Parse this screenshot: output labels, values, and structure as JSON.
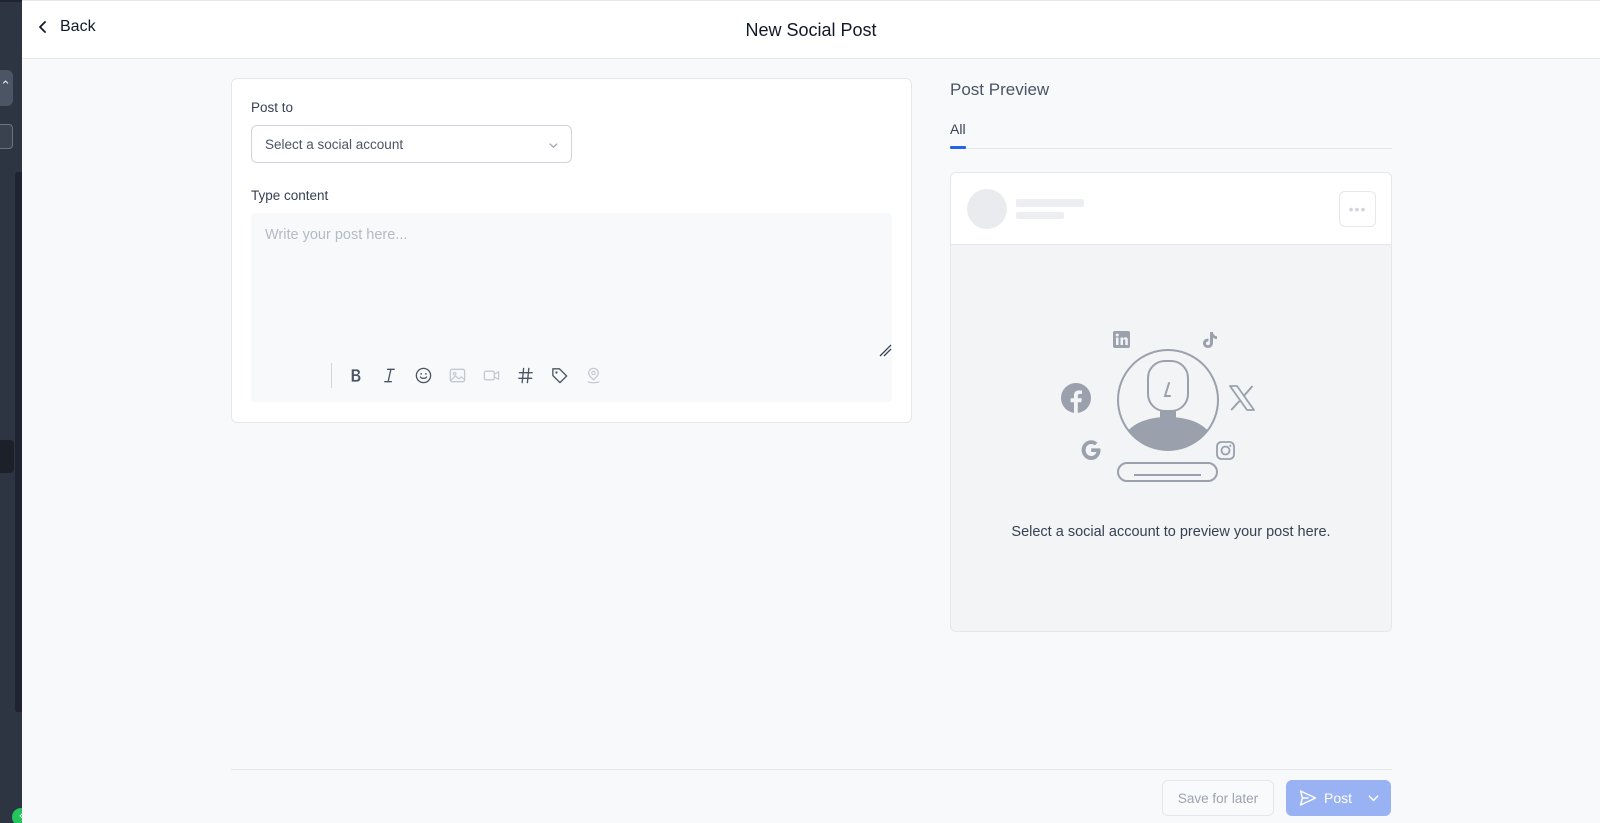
{
  "header": {
    "back_label": "Back",
    "title": "New Social Post"
  },
  "form": {
    "post_to_label": "Post to",
    "account_select_placeholder": "Select a social account",
    "content_label": "Type content",
    "content_placeholder": "Write your post here...",
    "content_value": "",
    "toolbar_icons": [
      "bold-icon",
      "italic-icon",
      "emoji-icon",
      "image-icon",
      "video-icon",
      "hashtag-icon",
      "tag-icon",
      "location-icon"
    ]
  },
  "preview": {
    "title": "Post Preview",
    "tabs": [
      {
        "label": "All",
        "active": true
      }
    ],
    "platform_icons": [
      "linkedin-icon",
      "tiktok-icon",
      "facebook-icon",
      "x-icon",
      "google-icon",
      "instagram-icon"
    ],
    "empty_message": "Select a social account to preview your post here."
  },
  "footer": {
    "save_label": "Save for later",
    "post_label": "Post"
  },
  "colors": {
    "accent": "#2563eb",
    "post_button": "#98b2f3",
    "rail": "#2d3442",
    "status_dot": "#22c55e"
  }
}
